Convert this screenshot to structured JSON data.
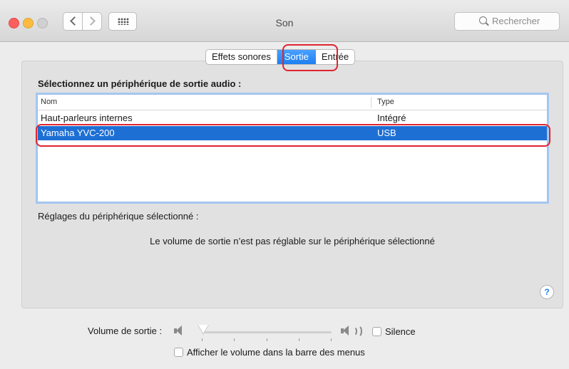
{
  "window": {
    "title": "Son"
  },
  "toolbar": {
    "back_icon": "chevron-left-icon",
    "forward_icon": "chevron-right-icon",
    "grid_icon": "grid-icon",
    "search_placeholder": "Rechercher"
  },
  "tabs": [
    {
      "label": "Effets sonores",
      "selected": false
    },
    {
      "label": "Sortie",
      "selected": true
    },
    {
      "label": "Entrée",
      "selected": false
    }
  ],
  "output": {
    "section_title": "Sélectionnez un périphérique de sortie audio :",
    "columns": [
      "Nom",
      "Type"
    ],
    "devices": [
      {
        "name": "Haut-parleurs internes",
        "type": "Intégré",
        "selected": false
      },
      {
        "name": "Yamaha YVC-200",
        "type": "USB",
        "selected": true
      }
    ],
    "settings_label": "Réglages du périphérique sélectionné :",
    "info_message": "Le volume de sortie n’est pas réglable sur le périphérique sélectionné"
  },
  "help": {
    "label": "?"
  },
  "volume": {
    "label": "Volume de sortie :",
    "level": 0,
    "mute_label": "Silence",
    "mute_checked": false,
    "show_in_menubar_label": "Afficher le volume dans la barre des menus",
    "show_in_menubar_checked": false
  },
  "colors": {
    "accent": "#1e7ff0",
    "selection": "#1d6fd4",
    "annotation": "#e0242f"
  }
}
